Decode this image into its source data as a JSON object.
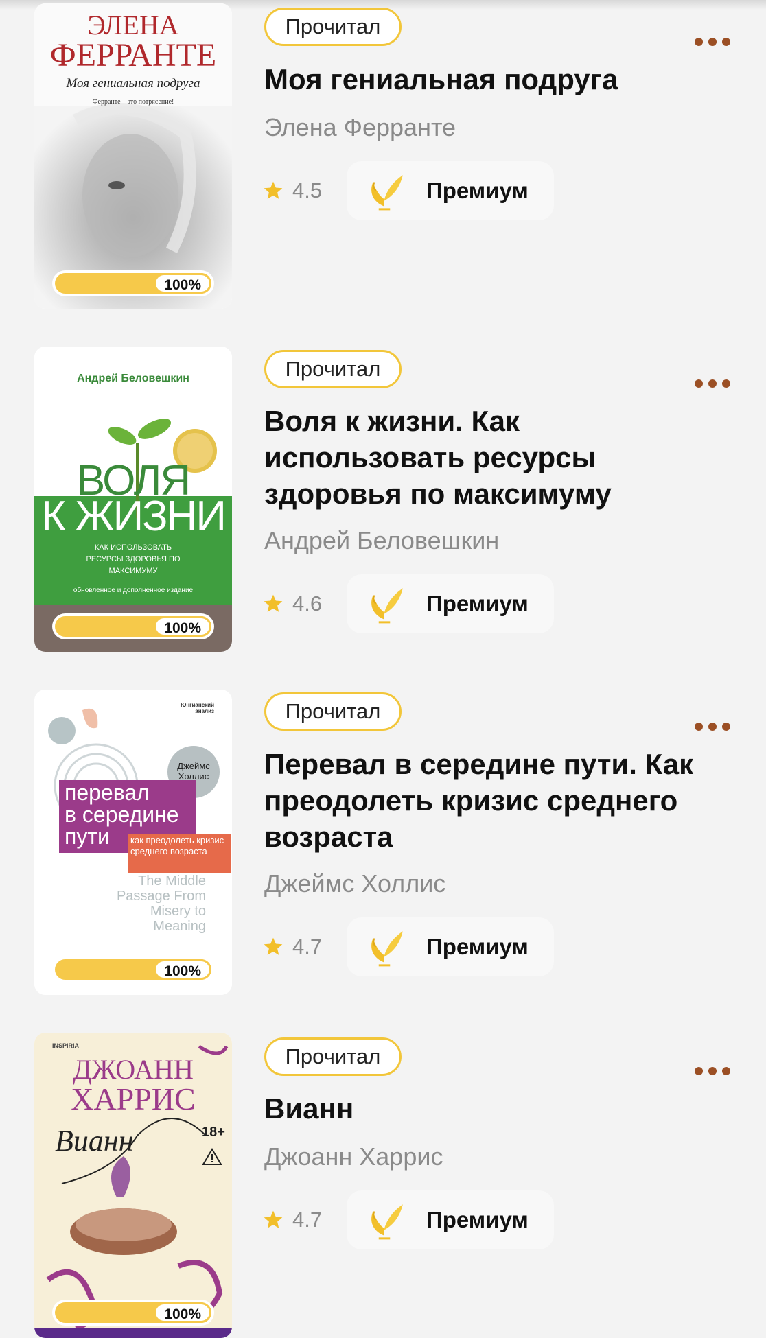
{
  "books": [
    {
      "status": "Прочитал",
      "title": "Моя гениальная подруга",
      "author": "Элена Ферранте",
      "rating": "4.5",
      "badge": "Премиум",
      "progress": "100%",
      "cover": {
        "line1": "ЭЛЕНА",
        "line2": "ФЕРРАНТЕ",
        "subtitle": "Моя гениальная подруга",
        "quote": "Ферранте – это потрясение!"
      }
    },
    {
      "status": "Прочитал",
      "title": "Воля к жизни. Как использовать ресурсы здоровья по максимуму",
      "author": "Андрей Беловешкин",
      "rating": "4.6",
      "badge": "Премиум",
      "progress": "100%",
      "cover": {
        "author": "Андрей Беловешкин",
        "line1": "ВОЛЯ",
        "line2": "К ЖИЗНИ",
        "subtitle": "КАК ИСПОЛЬЗОВАТЬ РЕСУРСЫ ЗДОРОВЬЯ ПО МАКСИМУМУ",
        "edition": "обновленное и дополненное издание"
      }
    },
    {
      "status": "Прочитал",
      "title": "Перевал в середине пути. Как преодолеть кризис среднего возраста",
      "author": "Джеймс Холлис",
      "rating": "4.7",
      "badge": "Премиум",
      "progress": "100%",
      "cover": {
        "series": "Юнгианский анализ",
        "author": "Джеймс Холлис",
        "line1": "перевал",
        "line2": "в середине",
        "line3": "пути",
        "subtitle": "как преодолеть кризис среднего возраста",
        "english": "The Middle Passage From Misery to Meaning"
      }
    },
    {
      "status": "Прочитал",
      "title": "Вианн",
      "author": "Джоанн Харрис",
      "rating": "4.7",
      "badge": "Премиум",
      "progress": "100%",
      "cover": {
        "publisher": "INSPIRIA",
        "line1": "ДЖОАНН",
        "line2": "ХАРРИС",
        "script": "Вианн",
        "age": "18+"
      }
    }
  ]
}
